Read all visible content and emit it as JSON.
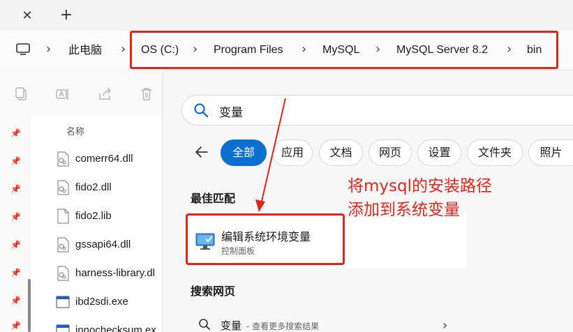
{
  "tabbar": {
    "close_glyph": "✕",
    "new_tab_glyph": "+"
  },
  "breadcrumb": {
    "root_icon": "computer-icon",
    "items": [
      "此电脑",
      "OS (C:)",
      "Program Files",
      "MySQL",
      "MySQL Server 8.2",
      "bin"
    ],
    "separator": "›"
  },
  "commandbar": {
    "icons": [
      "copy-icon",
      "rename-icon",
      "share-icon",
      "delete-icon"
    ]
  },
  "filelist": {
    "header": "名称",
    "files": [
      {
        "name": "comerr64.dll",
        "icon": "dll-file-icon"
      },
      {
        "name": "fido2.dll",
        "icon": "dll-file-icon"
      },
      {
        "name": "fido2.lib",
        "icon": "file-icon"
      },
      {
        "name": "gssapi64.dll",
        "icon": "dll-file-icon"
      },
      {
        "name": "harness-library.dl",
        "icon": "dll-file-icon"
      },
      {
        "name": "ibd2sdi.exe",
        "icon": "exe-file-icon"
      },
      {
        "name": "innochecksum.ex",
        "icon": "exe-file-icon"
      }
    ]
  },
  "search": {
    "query": "变量",
    "filters": [
      "全部",
      "应用",
      "文档",
      "网页",
      "设置",
      "文件夹",
      "照片"
    ],
    "active_filter": "全部",
    "best_match_title": "最佳匹配",
    "best_match": {
      "title": "编辑系统环境变量",
      "subtitle": "控制面板",
      "icon": "control-panel-icon"
    },
    "web_title": "搜索网页",
    "web_result": {
      "term": "变量",
      "subtitle": " - 查看更多搜索结果"
    }
  },
  "annotation": {
    "lines": [
      "将mysql的安装路径",
      "添加到系统变量"
    ],
    "color": "#e0261b"
  },
  "colors": {
    "accent": "#0b6fd0",
    "highlight": "#e0261b"
  }
}
